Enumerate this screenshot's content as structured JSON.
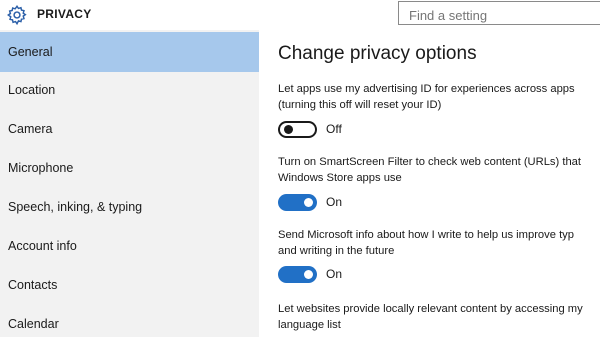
{
  "header": {
    "title": "PRIVACY",
    "search_placeholder": "Find a setting"
  },
  "sidebar": {
    "items": [
      {
        "label": "General",
        "selected": true
      },
      {
        "label": "Location"
      },
      {
        "label": "Camera"
      },
      {
        "label": "Microphone"
      },
      {
        "label": "Speech, inking, & typing"
      },
      {
        "label": "Account info"
      },
      {
        "label": "Contacts"
      },
      {
        "label": "Calendar"
      }
    ]
  },
  "main": {
    "heading": "Change privacy options",
    "options": [
      {
        "line1": "Let apps use my advertising ID for experiences across apps",
        "line2": "(turning this off will reset your ID)",
        "state": "Off"
      },
      {
        "line1": "Turn on SmartScreen Filter to check web content (URLs) that",
        "line2": "Windows Store apps use",
        "state": "On"
      },
      {
        "line1": "Send Microsoft info about how I write to help us improve typ",
        "line2": "and writing in the future",
        "state": "On"
      },
      {
        "line1": "Let websites provide locally relevant content by accessing my",
        "line2": "language list"
      }
    ]
  },
  "colors": {
    "accent": "#2170c6",
    "selected_nav": "#a6c8ec",
    "sidebar_bg": "#f2f2f2"
  }
}
